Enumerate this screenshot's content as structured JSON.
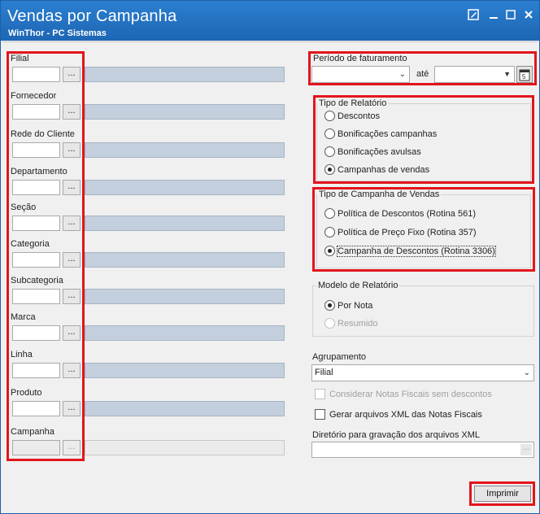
{
  "window": {
    "title": "Vendas por Campanha",
    "subtitle": "WinThor - PC Sistemas",
    "controls": [
      "edit-icon",
      "minimize-icon",
      "maximize-icon",
      "close-icon"
    ]
  },
  "filters": {
    "dots_label": "...",
    "items": [
      {
        "label": "Filial"
      },
      {
        "label": "Fornecedor"
      },
      {
        "label": "Rede do Cliente"
      },
      {
        "label": "Departamento"
      },
      {
        "label": "Seção"
      },
      {
        "label": "Categoria"
      },
      {
        "label": "Subcategoria"
      },
      {
        "label": "Marca"
      },
      {
        "label": "Linha"
      },
      {
        "label": "Produto"
      },
      {
        "label": "Campanha"
      }
    ]
  },
  "periodo": {
    "label": "Período de faturamento",
    "ate_label": "até"
  },
  "tipo_relatorio": {
    "label": "Tipo de Relatório",
    "options": [
      "Descontos",
      "Bonificações campanhas",
      "Bonificações avulsas",
      "Campanhas de vendas"
    ],
    "selected": "Campanhas de vendas"
  },
  "tipo_campanha": {
    "label": "Tipo de Campanha de Vendas",
    "options": [
      "Política de Descontos (Rotina 561)",
      "Política de Preço Fixo (Rotina 357)",
      "Campanha de Descontos (Rotina 3306)"
    ],
    "selected": "Campanha de Descontos (Rotina 3306)"
  },
  "modelo_relatorio": {
    "label": "Modelo de Relatório",
    "options": [
      "Por Nota",
      "Resumido"
    ],
    "selected": "Por Nota"
  },
  "agrupamento": {
    "label": "Agrupamento",
    "value": "Filial"
  },
  "checks": {
    "considerar": "Considerar Notas Fiscais sem descontos",
    "gerar_xml": "Gerar arquivos XML das Notas Fiscais"
  },
  "diretorio": {
    "label": "Diretório para gravação dos arquivos XML",
    "value": ""
  },
  "imprimir_label": "Imprimir",
  "colors": {
    "titlebar": "#1d66b4",
    "highlight": "#e3141b",
    "description_field": "#c3cfdc"
  }
}
